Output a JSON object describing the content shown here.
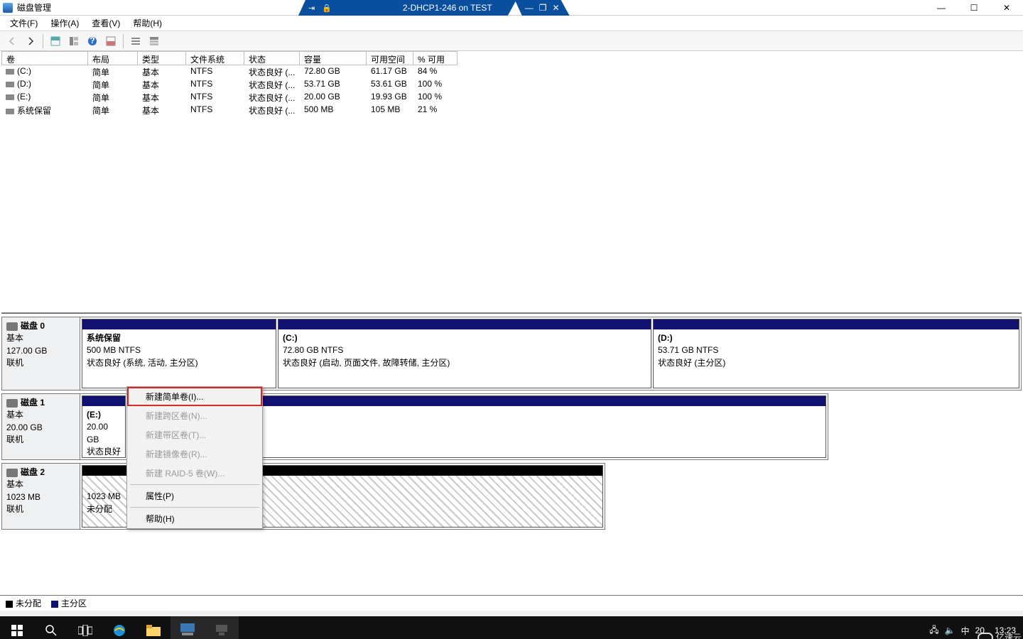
{
  "outer": {
    "title": "磁盘管理",
    "vmname": "2-DHCP1-246 on TEST"
  },
  "menu": {
    "file": "文件(F)",
    "action": "操作(A)",
    "view": "查看(V)",
    "help": "帮助(H)"
  },
  "columns": {
    "vol": "卷",
    "layout": "布局",
    "type": "类型",
    "fs": "文件系统",
    "status": "状态",
    "capacity": "容量",
    "free": "可用空间",
    "pct": "% 可用"
  },
  "volumes": [
    {
      "name": "(C:)",
      "layout": "简单",
      "type": "基本",
      "fs": "NTFS",
      "status": "状态良好 (...",
      "capacity": "72.80 GB",
      "free": "61.17 GB",
      "pct": "84 %"
    },
    {
      "name": "(D:)",
      "layout": "简单",
      "type": "基本",
      "fs": "NTFS",
      "status": "状态良好 (...",
      "capacity": "53.71 GB",
      "free": "53.61 GB",
      "pct": "100 %"
    },
    {
      "name": "(E:)",
      "layout": "简单",
      "type": "基本",
      "fs": "NTFS",
      "status": "状态良好 (...",
      "capacity": "20.00 GB",
      "free": "19.93 GB",
      "pct": "100 %"
    },
    {
      "name": "系统保留",
      "layout": "简单",
      "type": "基本",
      "fs": "NTFS",
      "status": "状态良好 (...",
      "capacity": "500 MB",
      "free": "105 MB",
      "pct": "21 %"
    }
  ],
  "disks": {
    "d0": {
      "title": "磁盘 0",
      "kind": "基本",
      "size": "127.00 GB",
      "state": "联机",
      "p0": {
        "name": "系统保留",
        "sz": "500 MB NTFS",
        "st": "状态良好 (系统, 活动, 主分区)"
      },
      "p1": {
        "name": "(C:)",
        "sz": "72.80 GB NTFS",
        "st": "状态良好 (启动, 页面文件, 故障转储, 主分区)"
      },
      "p2": {
        "name": "(D:)",
        "sz": "53.71 GB NTFS",
        "st": "状态良好 (主分区)"
      }
    },
    "d1": {
      "title": "磁盘 1",
      "kind": "基本",
      "size": "20.00 GB",
      "state": "联机",
      "p0": {
        "name": "(E:)",
        "sz": "20.00 GB",
        "st": "状态良好 ("
      }
    },
    "d2": {
      "title": "磁盘 2",
      "kind": "基本",
      "size": "1023 MB",
      "state": "联机",
      "p0": {
        "sz": "1023 MB",
        "st": "未分配"
      }
    }
  },
  "ctx": {
    "simple": "新建简单卷(I)...",
    "span": "新建跨区卷(N)...",
    "stripe": "新建带区卷(T)...",
    "mirror": "新建镜像卷(R)...",
    "raid5": "新建 RAID-5 卷(W)...",
    "prop": "属性(P)",
    "help": "帮助(H)"
  },
  "legend": {
    "unalloc": "未分配",
    "primary": "主分区"
  },
  "tray": {
    "ime": "中",
    "year": "20",
    "time": "13:23"
  },
  "watermark": "亿速云"
}
